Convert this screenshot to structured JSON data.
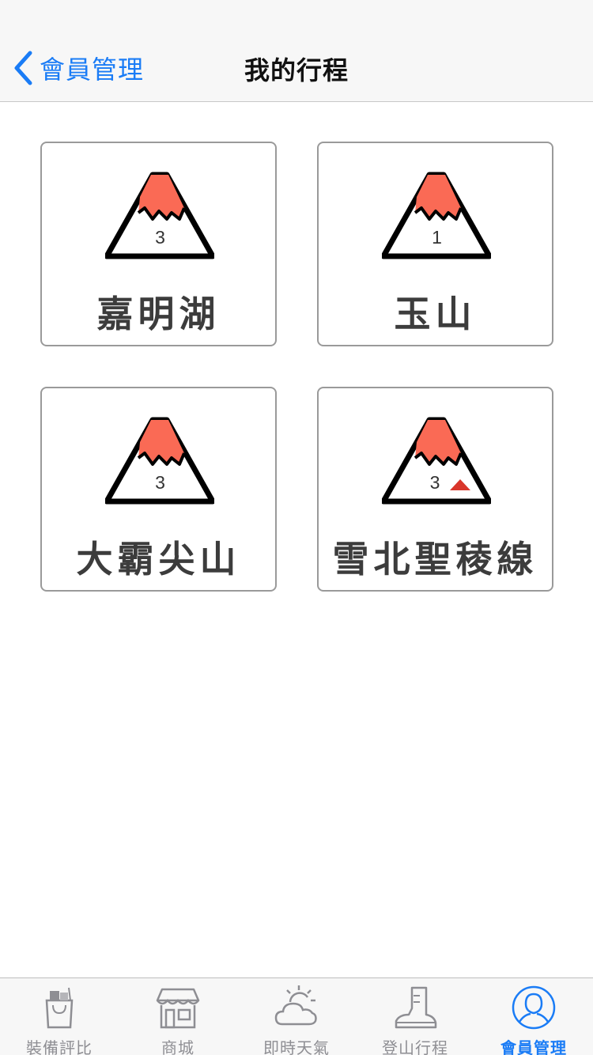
{
  "nav": {
    "back_label": "會員管理",
    "title": "我的行程"
  },
  "trips": [
    {
      "name": "嘉明湖",
      "number": "3",
      "warning": false
    },
    {
      "name": "玉山",
      "number": "1",
      "warning": false
    },
    {
      "name": "大霸尖山",
      "number": "3",
      "warning": false
    },
    {
      "name": "雪北聖稜線",
      "number": "3",
      "warning": true
    }
  ],
  "tabs": [
    {
      "label": "裝備評比",
      "icon": "shopping-bag-icon",
      "active": false
    },
    {
      "label": "商城",
      "icon": "storefront-icon",
      "active": false
    },
    {
      "label": "即時天氣",
      "icon": "weather-icon",
      "active": false
    },
    {
      "label": "登山行程",
      "icon": "hiking-boot-icon",
      "active": false
    },
    {
      "label": "會員管理",
      "icon": "user-icon",
      "active": true
    }
  ],
  "colors": {
    "accent": "#1a7cf6",
    "peak": "#fa6a55",
    "warning": "#d9362b",
    "inactive": "#8e8e93"
  }
}
